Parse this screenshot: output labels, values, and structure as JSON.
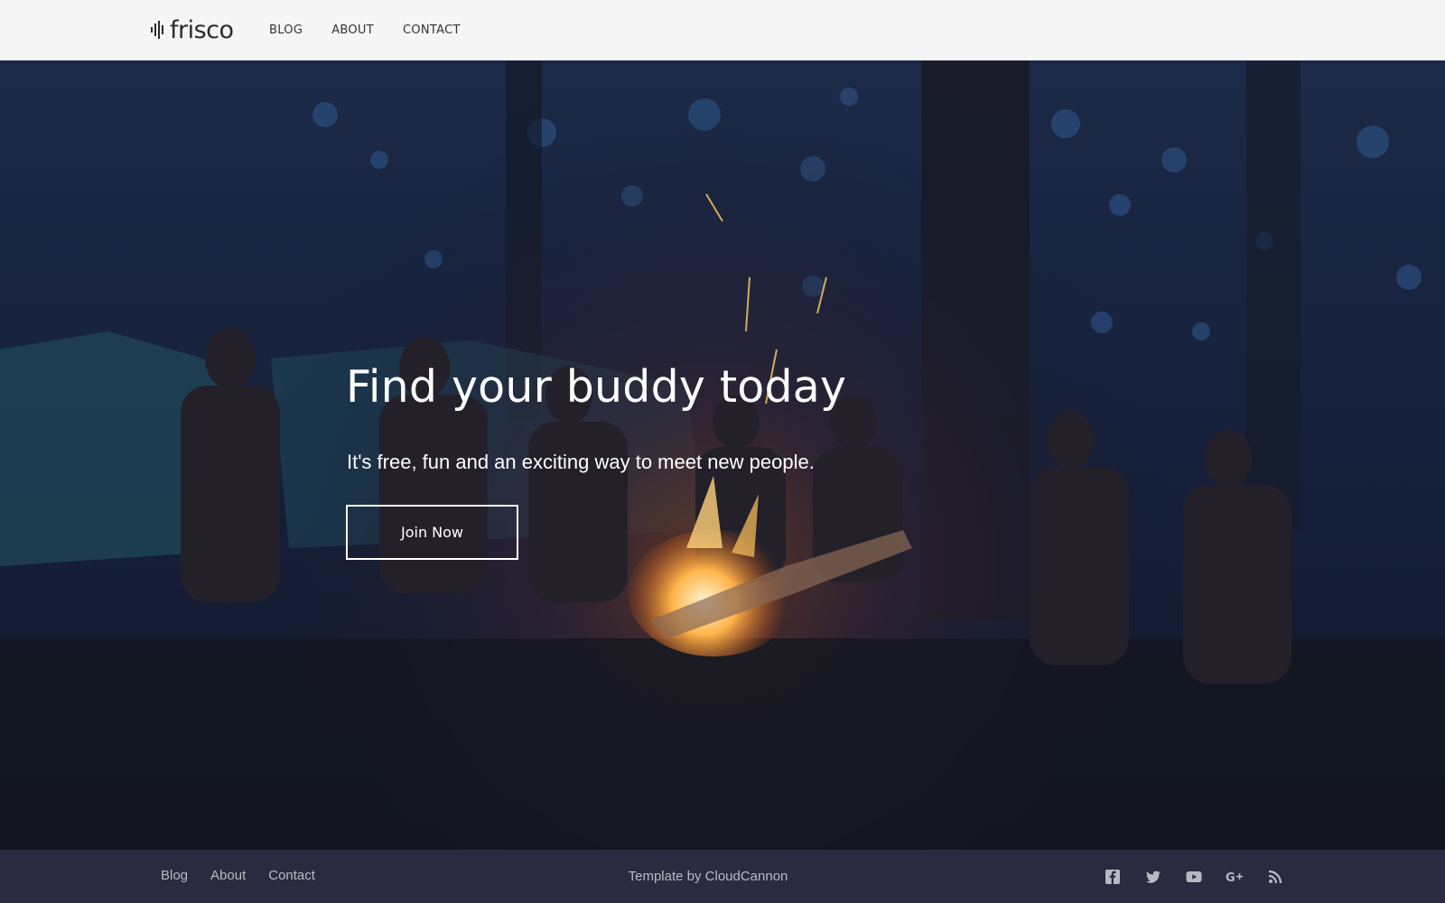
{
  "header": {
    "logo_text": "frisco",
    "logo_icon": "waveform-icon",
    "nav": [
      {
        "label": "BLOG"
      },
      {
        "label": "ABOUT"
      },
      {
        "label": "CONTACT"
      }
    ]
  },
  "hero": {
    "title": "Find your buddy today",
    "subtitle": "It's free, fun and an exciting way to meet new people.",
    "cta_label": "Join Now"
  },
  "footer": {
    "links": [
      {
        "label": "Blog"
      },
      {
        "label": "About"
      },
      {
        "label": "Contact"
      }
    ],
    "credit": "Template by CloudCannon",
    "social_icons": [
      "facebook-icon",
      "twitter-icon",
      "youtube-icon",
      "google-plus-icon",
      "rss-icon"
    ]
  },
  "colors": {
    "header_bg": "#f5f5f5",
    "footer_bg": "#2b2a40",
    "hero_overlay": "#121a2e",
    "text_light": "#ffffff",
    "footer_text": "#b9b9c5"
  }
}
